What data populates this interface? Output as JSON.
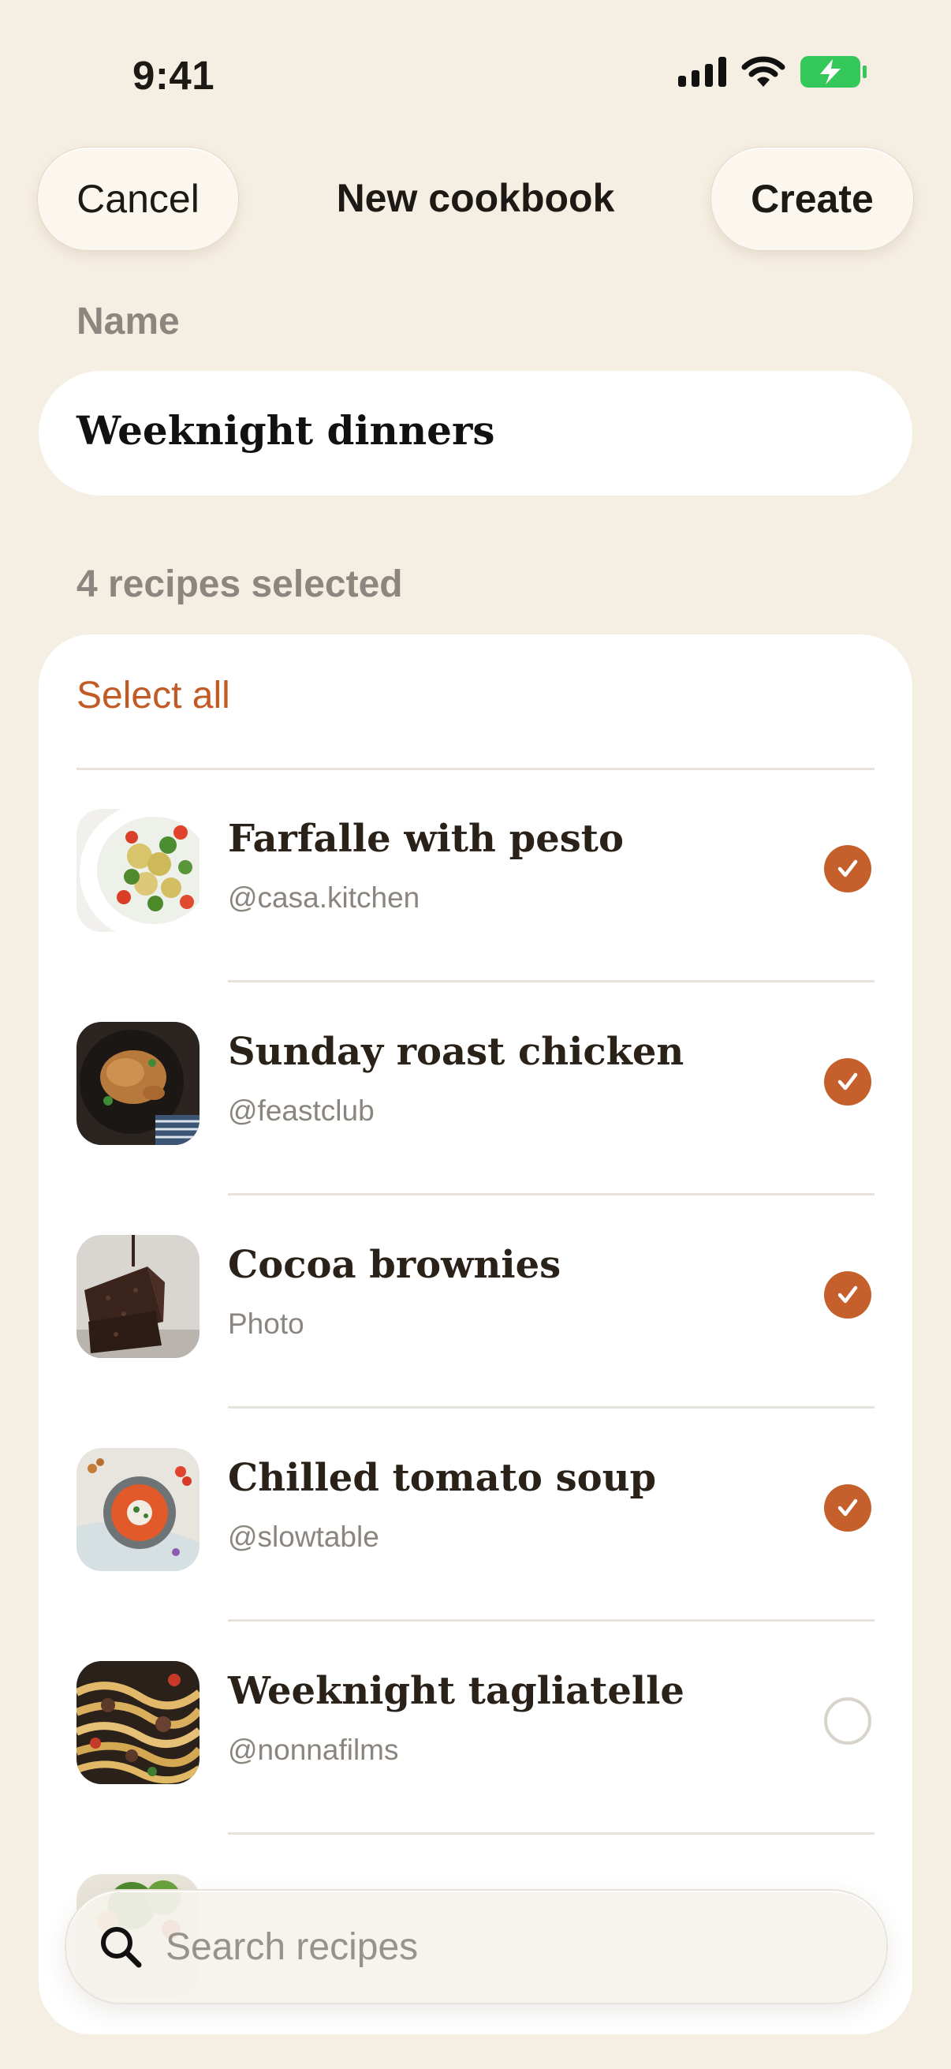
{
  "status_bar": {
    "time": "9:41"
  },
  "nav": {
    "cancel_label": "Cancel",
    "title": "New cookbook",
    "create_label": "Create"
  },
  "name_section": {
    "label": "Name",
    "value": "Weeknight dinners"
  },
  "selection": {
    "count_label": "4 recipes selected",
    "select_all_label": "Select all"
  },
  "recipes": [
    {
      "title": "Farfalle with pesto",
      "source": "@casa.kitchen",
      "selected": true,
      "thumb": "pasta-salad"
    },
    {
      "title": "Sunday roast chicken",
      "source": "@feastclub",
      "selected": true,
      "thumb": "roast-chicken"
    },
    {
      "title": "Cocoa brownies",
      "source": "Photo",
      "selected": true,
      "thumb": "brownies"
    },
    {
      "title": "Chilled tomato soup",
      "source": "@slowtable",
      "selected": true,
      "thumb": "tomato-soup"
    },
    {
      "title": "Weeknight tagliatelle",
      "source": "@nonnafilms",
      "selected": false,
      "thumb": "tagliatelle"
    }
  ],
  "search": {
    "placeholder": "Search recipes"
  },
  "colors": {
    "accent": "#C5602D",
    "background": "#F5EEE2",
    "battery": "#34C759"
  }
}
